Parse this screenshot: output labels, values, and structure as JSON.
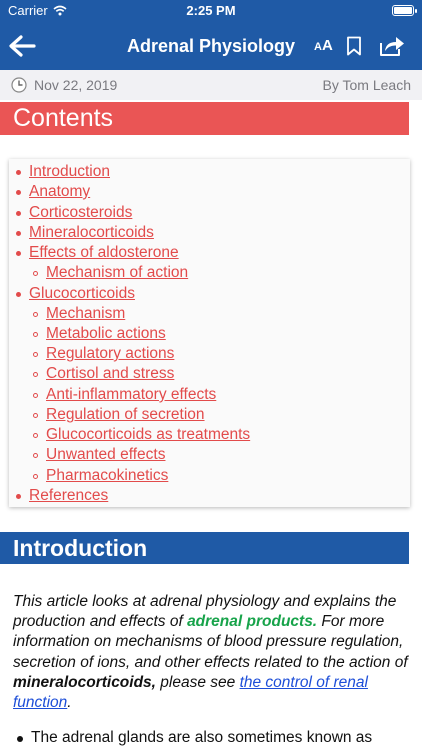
{
  "status_bar": {
    "carrier": "Carrier",
    "time": "2:25 PM"
  },
  "nav": {
    "title": "Adrenal Physiology",
    "font_size_label_small": "A",
    "font_size_label_large": "A"
  },
  "meta": {
    "date": "Nov 22, 2019",
    "author": "By Tom Leach"
  },
  "contents": {
    "heading": "Contents",
    "items": [
      {
        "label": "Introduction"
      },
      {
        "label": "Anatomy"
      },
      {
        "label": "Corticosteroids"
      },
      {
        "label": "Mineralocorticoids"
      },
      {
        "label": "Effects of aldosterone"
      },
      {
        "label": "Mechanism of action"
      },
      {
        "label": "Glucocorticoids"
      },
      {
        "label": "Mechanism"
      },
      {
        "label": "Metabolic actions"
      },
      {
        "label": "Regulatory actions"
      },
      {
        "label": "Cortisol and stress"
      },
      {
        "label": "Anti-inflammatory effects"
      },
      {
        "label": "Regulation of secretion"
      },
      {
        "label": "Glucocorticoids as treatments"
      },
      {
        "label": "Unwanted effects"
      },
      {
        "label": "Pharmacokinetics"
      },
      {
        "label": "References"
      }
    ]
  },
  "introduction": {
    "heading": "Introduction",
    "p1_a": "This article looks at adrenal physiology and explains the production and effects of ",
    "p1_highlight": "adrenal products.",
    "p1_b": " For more information on mechanisms of blood pressure regulation, secretion of ions, and other effects related to the action of ",
    "p1_bold": "mineralocorticoids,",
    "p1_c": " please see ",
    "p1_link": "the control of renal function",
    "p1_end": ".",
    "bullet_1": "The adrenal glands are also sometimes known as"
  },
  "colors": {
    "nav_blue": "#1f5aa6",
    "contents_red": "#ea5555",
    "link_red": "#e24b4b",
    "highlight_green": "#17a34a",
    "link_blue": "#1d4ed8"
  }
}
